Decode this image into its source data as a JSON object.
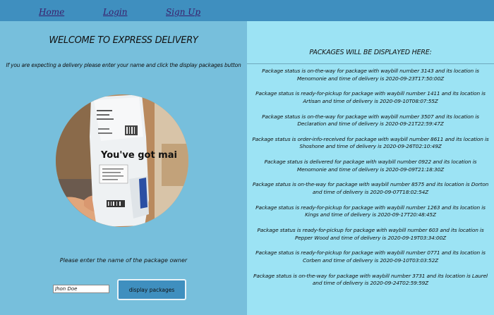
{
  "nav": {
    "links": [
      {
        "label": "Home"
      },
      {
        "label": "Login"
      },
      {
        "label": "Sign Up"
      }
    ]
  },
  "left": {
    "title": "WELCOME TO EXPRESS DELIVERY",
    "instructions": "If you are expecting a delivery please enter your name and click the display packages button",
    "photo_text": "You've got mai",
    "owner_label": "Please enter the name of the package owner",
    "name_input_value": "Jhon Doe",
    "display_button_label": "display packages"
  },
  "right": {
    "title": "PACKAGES WILL BE DISPLAYED HERE:",
    "packages": [
      {
        "text": "Package status is on-the-way for package with waybill number 3143 and its location is Menomonie and time of delivery is 2020-09-23T17:50:00Z"
      },
      {
        "text": "Package status is ready-for-pickup for package with waybill number 1411 and its location is Artisan and time of delivery is 2020-09-10T08:07:55Z"
      },
      {
        "text": "Package status is on-the-way for package with waybill number 3507 and its location is Declaration and time of delivery is 2020-09-21T22:59:47Z"
      },
      {
        "text": "Package status is order-info-received for package with waybill number 8611 and its location is Shoshone and time of delivery is 2020-09-26T02:10:49Z"
      },
      {
        "text": "Package status is delivered for package with waybill number 0922 and its location is Menomonie and time of delivery is 2020-09-09T21:18:30Z"
      },
      {
        "text": "Package status is on-the-way for package with waybill number 8575 and its location is Dorton and time of delivery is 2020-09-07T18:02:54Z"
      },
      {
        "text": "Package status is ready-for-pickup for package with waybill number 1263 and its location is Kings and time of delivery is 2020-09-17T20:48:45Z"
      },
      {
        "text": "Package status is ready-for-pickup for package with waybill number 603 and its location is Pepper Wood and time of delivery is 2020-09-19T03:34:00Z"
      },
      {
        "text": "Package status is ready-for-pickup for package with waybill number 0771 and its location is Corben and time of delivery is 2020-09-10T03:03:52Z"
      },
      {
        "text": "Package status is on-the-way for package with waybill number 3731 and its location is Laurel and time of delivery is 2020-09-24T02:59:59Z"
      }
    ]
  },
  "colors": {
    "nav_background": "#3f8fbf",
    "left_panel": "#77bfdc",
    "right_panel": "#9ce3f4",
    "button": "#3f8fbf",
    "link": "#3a1e6b"
  }
}
